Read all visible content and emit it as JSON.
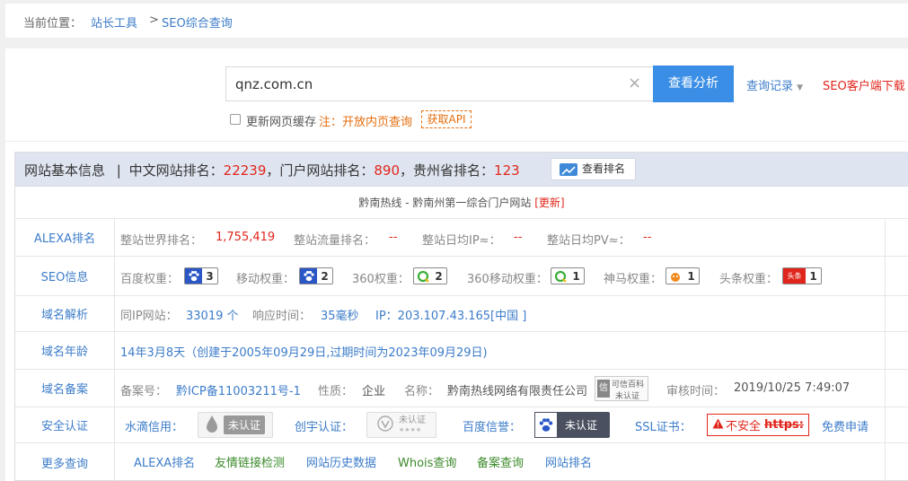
{
  "breadcrumb": {
    "prefix": "当前位置：",
    "crumb1": "站长工具",
    "separator": ">",
    "crumb2": "SEO综合查询"
  },
  "search": {
    "value": "qnz.com.cn",
    "clear_icon": "×",
    "button": "查看分析",
    "history": "查询记录",
    "history_caret": "▼",
    "client": "SEO客户端下载"
  },
  "options": {
    "refresh_cache": "更新网页缓存",
    "note": "注：开放内页查询",
    "api": "获取API"
  },
  "header": {
    "title": "网站基本信息",
    "pipe": "|",
    "cn_rank_label": "中文网站排名：",
    "cn_rank": "22239",
    "portal_rank_label": "，门户网站排名：",
    "portal_rank": "890",
    "province_rank_label": "，贵州省排名：",
    "province_rank": "123",
    "view_rank": "查看排名"
  },
  "site": {
    "title": "黔南热线 - 黔南州第一综合门户网站",
    "update": "[更新]"
  },
  "alexa": {
    "label": "ALEXA排名",
    "world_label": "整站世界排名：",
    "world": "1,755,419",
    "flow_label": "整站流量排名：",
    "flow": "--",
    "ip_label": "整站日均IP≈：",
    "ip": "--",
    "pv_label": "整站日均PV≈：",
    "pv": "--"
  },
  "seo": {
    "label": "SEO信息",
    "baidu_label": "百度权重：",
    "baidu": "3",
    "mobile_label": "移动权重：",
    "mobile": "2",
    "s360_label": "360权重：",
    "s360": "2",
    "s360m_label": "360移动权重：",
    "s360m": "1",
    "shenma_label": "神马权重：",
    "shenma": "1",
    "toutiao_label": "头条权重：",
    "toutiao": "1",
    "toutiao_icon_text": "头条"
  },
  "dns": {
    "label": "域名解析",
    "sameip_label": "同IP网站：",
    "sameip": "33019 个",
    "resp_label": "响应时间：",
    "resp": "35毫秒",
    "ip": "IP：203.107.43.165[中国 ]"
  },
  "age": {
    "label": "域名年龄",
    "value": "14年3月8天（创建于2005年09月29日,过期时间为2023年09月29日)"
  },
  "icp": {
    "label": "域名备案",
    "no_label": "备案号：",
    "no": "黔ICP备11003211号-1",
    "nature_label": "性质：",
    "nature": "企业",
    "name_label": "名称：",
    "name": "黔南热线网络有限责任公司",
    "kexin_top": "可信百科",
    "kexin_bottom": "未认证",
    "kexin_icon": "信",
    "audit_label": "审核时间：",
    "audit": "2019/10/25 7:49:07"
  },
  "security": {
    "label": "安全认证",
    "shuidi_label": "水滴信用：",
    "shuidi": "未认证",
    "chuangzi_label": "创宇认证：",
    "chuangzi": "未认证",
    "chuangzi_stars": "★★★★",
    "baidu_label": "百度信誉：",
    "baidu": "未认证",
    "ssl_label": "SSL证书：",
    "ssl_warn": "不安全",
    "ssl_https": "https:",
    "ssl_apply": "免费申请"
  },
  "more": {
    "label": "更多查询",
    "links": [
      "ALEXA排名",
      "友情链接检测",
      "网站历史数据",
      "Whois查询",
      "备案查询",
      "网站排名"
    ]
  },
  "colors": {
    "accent": "#3b8ee5",
    "link": "#3c7cc9",
    "alert": "#e0261c",
    "warning": "#e46d0c",
    "header_bg": "#dfe5f0"
  }
}
